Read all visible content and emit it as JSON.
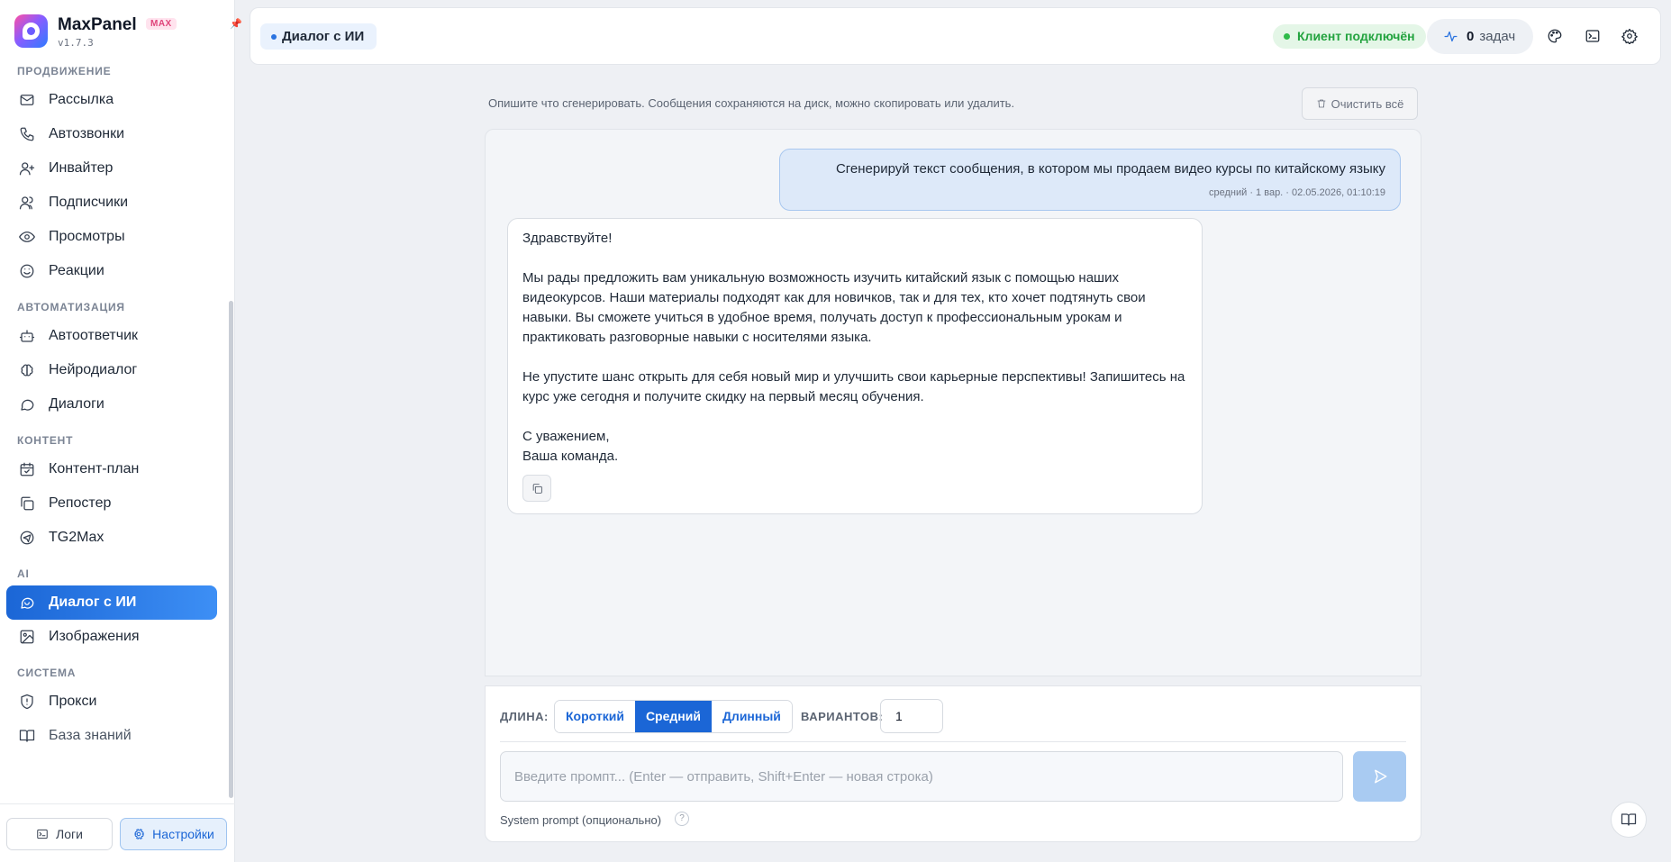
{
  "app": {
    "name": "MaxPanel",
    "badge": "MAX",
    "version": "v1.7.3"
  },
  "sidebar": {
    "sections": [
      {
        "title": "ПРОДВИЖЕНИЕ",
        "items": [
          {
            "label": "Рассылка",
            "icon": "mail-icon"
          },
          {
            "label": "Автозвонки",
            "icon": "phone-icon"
          },
          {
            "label": "Инвайтер",
            "icon": "user-plus-icon"
          },
          {
            "label": "Подписчики",
            "icon": "users-icon"
          },
          {
            "label": "Просмотры",
            "icon": "eye-icon"
          },
          {
            "label": "Реакции",
            "icon": "smile-icon"
          }
        ]
      },
      {
        "title": "АВТОМАТИЗАЦИЯ",
        "items": [
          {
            "label": "Автоответчик",
            "icon": "bot-icon"
          },
          {
            "label": "Нейродиалог",
            "icon": "brain-icon"
          },
          {
            "label": "Диалоги",
            "icon": "chat-bubble-icon"
          }
        ]
      },
      {
        "title": "КОНТЕНТ",
        "items": [
          {
            "label": "Контент-план",
            "icon": "calendar-icon"
          },
          {
            "label": "Репостер",
            "icon": "copy-icon"
          },
          {
            "label": "TG2Max",
            "icon": "telegram-icon"
          }
        ]
      },
      {
        "title": "AI",
        "items": [
          {
            "label": "Диалог с ИИ",
            "icon": "ai-chat-icon"
          },
          {
            "label": "Изображения",
            "icon": "image-icon"
          }
        ]
      },
      {
        "title": "СИСТЕМА",
        "items": [
          {
            "label": "Прокси",
            "icon": "shield-icon"
          },
          {
            "label": "База знаний",
            "icon": "book-icon"
          }
        ]
      }
    ],
    "footer": {
      "logs_label": "Логи",
      "settings_label": "Настройки"
    }
  },
  "header": {
    "breadcrumb": "Диалог с ИИ",
    "status": "Клиент подключён",
    "tasks_count": "0",
    "tasks_label": "задач"
  },
  "main": {
    "hint": "Опишите что сгенерировать. Сообщения сохраняются на диск, можно скопировать или удалить.",
    "clear_label": "Очистить всё",
    "user_message": {
      "text": "Сгенерируй текст сообщения, в котором мы продаем видео курсы по китайскому языку",
      "meta": "средний · 1 вар. · 02.05.2026, 01:10:19"
    },
    "ai_message": {
      "paragraphs": [
        "Здравствуйте!",
        "Мы рады предложить вам уникальную возможность изучить китайский язык с помощью наших видеокурсов. Наши материалы подходят как для новичков, так и для тех, кто хочет подтянуть свои навыки. Вы сможете учиться в удобное время, получать доступ к профессиональным урокам и практиковать разговорные навыки с носителями языка.",
        "Не упустите шанс открыть для себя новый мир и улучшить свои карьерные перспективы! Запишитесь на курс уже сегодня и получите скидку на первый месяц обучения.",
        "С уважением,\nВаша команда."
      ]
    }
  },
  "composer": {
    "length_label": "ДЛИНА:",
    "length_options": [
      "Короткий",
      "Средний",
      "Длинный"
    ],
    "length_selected": "Средний",
    "variants_label": "ВАРИАНТОВ:",
    "variants_value": "1",
    "prompt_placeholder": "Введите промпт... (Enter — отправить, Shift+Enter — новая строка)",
    "system_prompt_label": "System prompt (опционально)",
    "help_glyph": "?"
  },
  "colors": {
    "accent": "#1b66d6",
    "status_green": "#23a33f",
    "brand_badge": "#e0457b"
  }
}
